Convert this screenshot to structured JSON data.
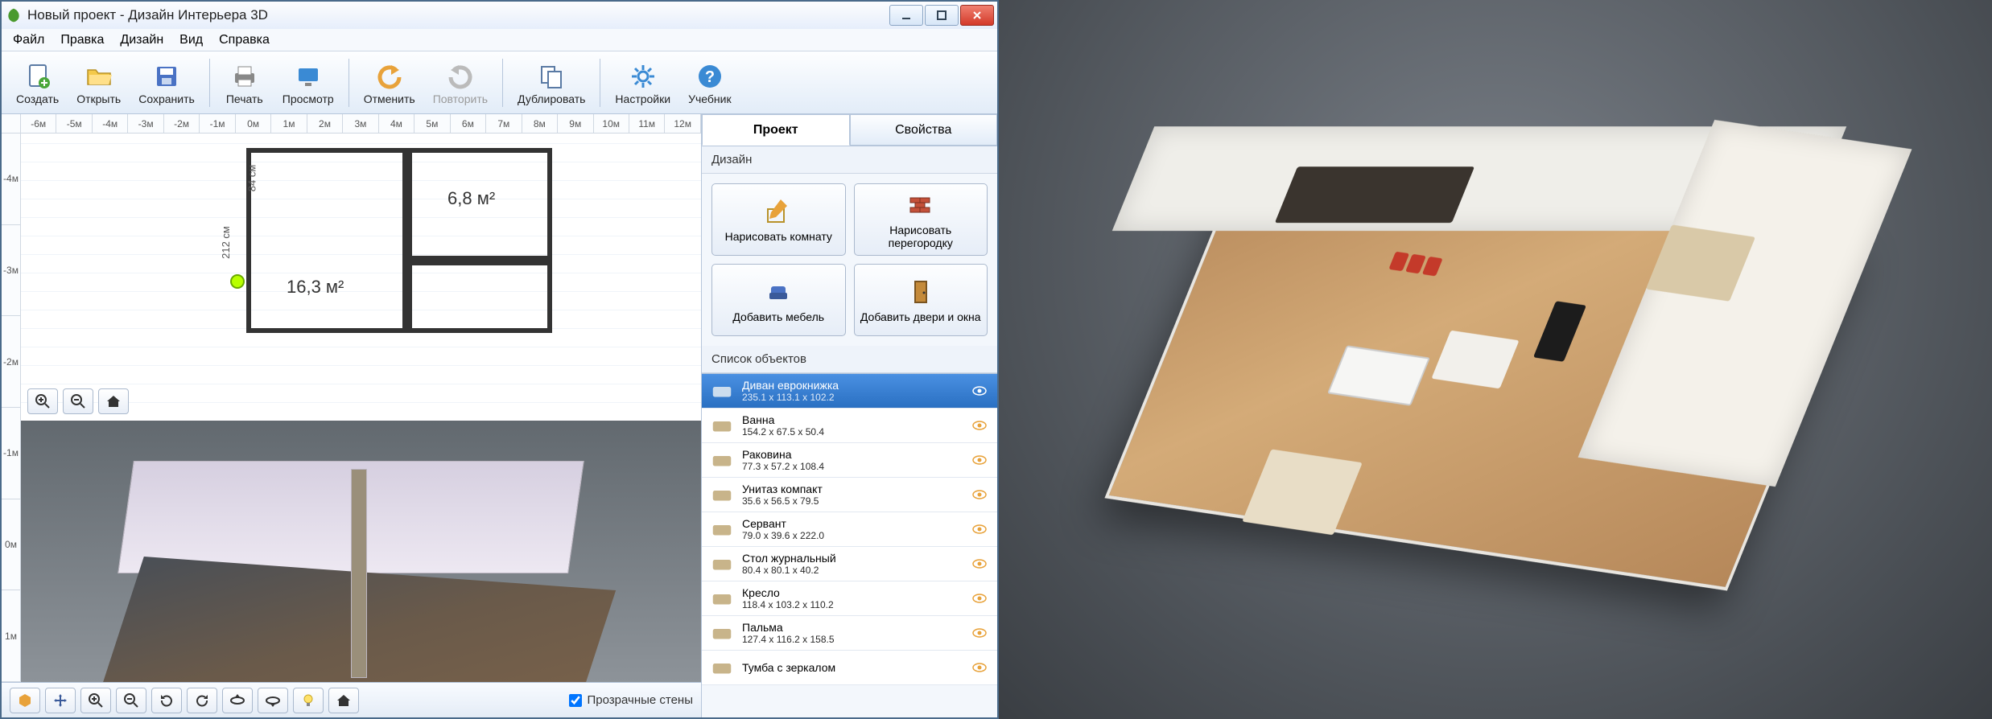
{
  "window": {
    "title": "Новый проект - Дизайн Интерьера 3D"
  },
  "menu": {
    "items": [
      "Файл",
      "Правка",
      "Дизайн",
      "Вид",
      "Справка"
    ]
  },
  "toolbar": {
    "items": [
      {
        "id": "create",
        "label": "Создать"
      },
      {
        "id": "open",
        "label": "Открыть"
      },
      {
        "id": "save",
        "label": "Сохранить"
      },
      {
        "id": "print",
        "label": "Печать"
      },
      {
        "id": "preview",
        "label": "Просмотр"
      },
      {
        "id": "undo",
        "label": "Отменить"
      },
      {
        "id": "redo",
        "label": "Повторить",
        "disabled": true
      },
      {
        "id": "duplicate",
        "label": "Дублировать"
      },
      {
        "id": "settings",
        "label": "Настройки"
      },
      {
        "id": "tutorial",
        "label": "Учебник"
      }
    ]
  },
  "ruler": {
    "h": [
      "-6м",
      "-5м",
      "-4м",
      "-3м",
      "-2м",
      "-1м",
      "0м",
      "1м",
      "2м",
      "3м",
      "4м",
      "5м",
      "6м",
      "7м",
      "8м",
      "9м",
      "10м",
      "11м",
      "12м"
    ],
    "v": [
      "-4м",
      "-3м",
      "-2м",
      "-1м",
      "0м",
      "1м"
    ]
  },
  "plan": {
    "roomA_area": "16,3 м²",
    "roomB_area": "6,8 м²",
    "dim_h": "212 см",
    "dim_v": "84 см"
  },
  "bottom": {
    "transparent_walls": "Прозрачные стены"
  },
  "side": {
    "tab_project": "Проект",
    "tab_properties": "Свойства",
    "section_design": "Дизайн",
    "btn_draw_room": "Нарисовать комнату",
    "btn_draw_partition": "Нарисовать перегородку",
    "btn_add_furniture": "Добавить мебель",
    "btn_add_doors": "Добавить двери и окна",
    "section_objects": "Список объектов",
    "objects": [
      {
        "name": "Диван еврокнижка",
        "dims": "235.1 x 113.1 x 102.2",
        "selected": true
      },
      {
        "name": "Ванна",
        "dims": "154.2 x 67.5 x 50.4"
      },
      {
        "name": "Раковина",
        "dims": "77.3 x 57.2 x 108.4"
      },
      {
        "name": "Унитаз компакт",
        "dims": "35.6 x 56.5 x 79.5"
      },
      {
        "name": "Сервант",
        "dims": "79.0 x 39.6 x 222.0"
      },
      {
        "name": "Стол журнальный",
        "dims": "80.4 x 80.1 x 40.2"
      },
      {
        "name": "Кресло",
        "dims": "118.4 x 103.2 x 110.2"
      },
      {
        "name": "Пальма",
        "dims": "127.4 x 116.2 x 158.5"
      },
      {
        "name": "Тумба с зеркалом",
        "dims": ""
      }
    ]
  }
}
